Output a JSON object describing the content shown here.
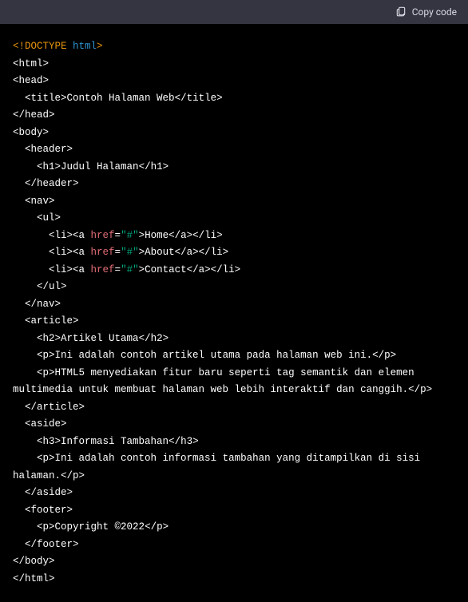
{
  "header": {
    "copy_label": "Copy code"
  },
  "code": {
    "doctype_open": "<!DOCTYPE ",
    "doctype_kw": "html",
    "doctype_close": ">",
    "html_open": "<html>",
    "head_open": "<head>",
    "title_open_indent": "  <title>",
    "title_text": "Contoh Halaman Web",
    "title_close": "</title>",
    "head_close": "</head>",
    "body_open": "<body>",
    "header_open": "  <header>",
    "h1_open": "    <h1>",
    "h1_text": "Judul Halaman",
    "h1_close": "</h1>",
    "header_close_tag": "  </header>",
    "nav_open": "  <nav>",
    "ul_open": "    <ul>",
    "li_open": "      <li><a ",
    "href_attr": "href",
    "eq": "=",
    "href_val": "\"#\"",
    "a_close_gt": ">",
    "li1_text": "Home",
    "li_tail": "</a></li>",
    "li2_text": "About",
    "li3_text": "Contact",
    "ul_close": "    </ul>",
    "nav_close": "  </nav>",
    "article_open": "  <article>",
    "h2_open": "    <h2>",
    "h2_text": "Artikel Utama",
    "h2_close": "</h2>",
    "p_open": "    <p>",
    "p1_text": "Ini adalah contoh artikel utama pada halaman web ini.",
    "p_close": "</p>",
    "p2_text": "HTML5 menyediakan fitur baru seperti tag semantik dan elemen multimedia untuk membuat halaman web lebih interaktif dan canggih.",
    "article_close": "  </article>",
    "aside_open": "  <aside>",
    "h3_open": "    <h3>",
    "h3_text": "Informasi Tambahan",
    "h3_close": "</h3>",
    "p3_text": "Ini adalah contoh informasi tambahan yang ditampilkan di sisi halaman.",
    "aside_close": "  </aside>",
    "footer_open": "  <footer>",
    "p4_text": "Copyright ©2022",
    "footer_close": "  </footer>",
    "body_close": "</body>",
    "html_close": "</html>"
  }
}
